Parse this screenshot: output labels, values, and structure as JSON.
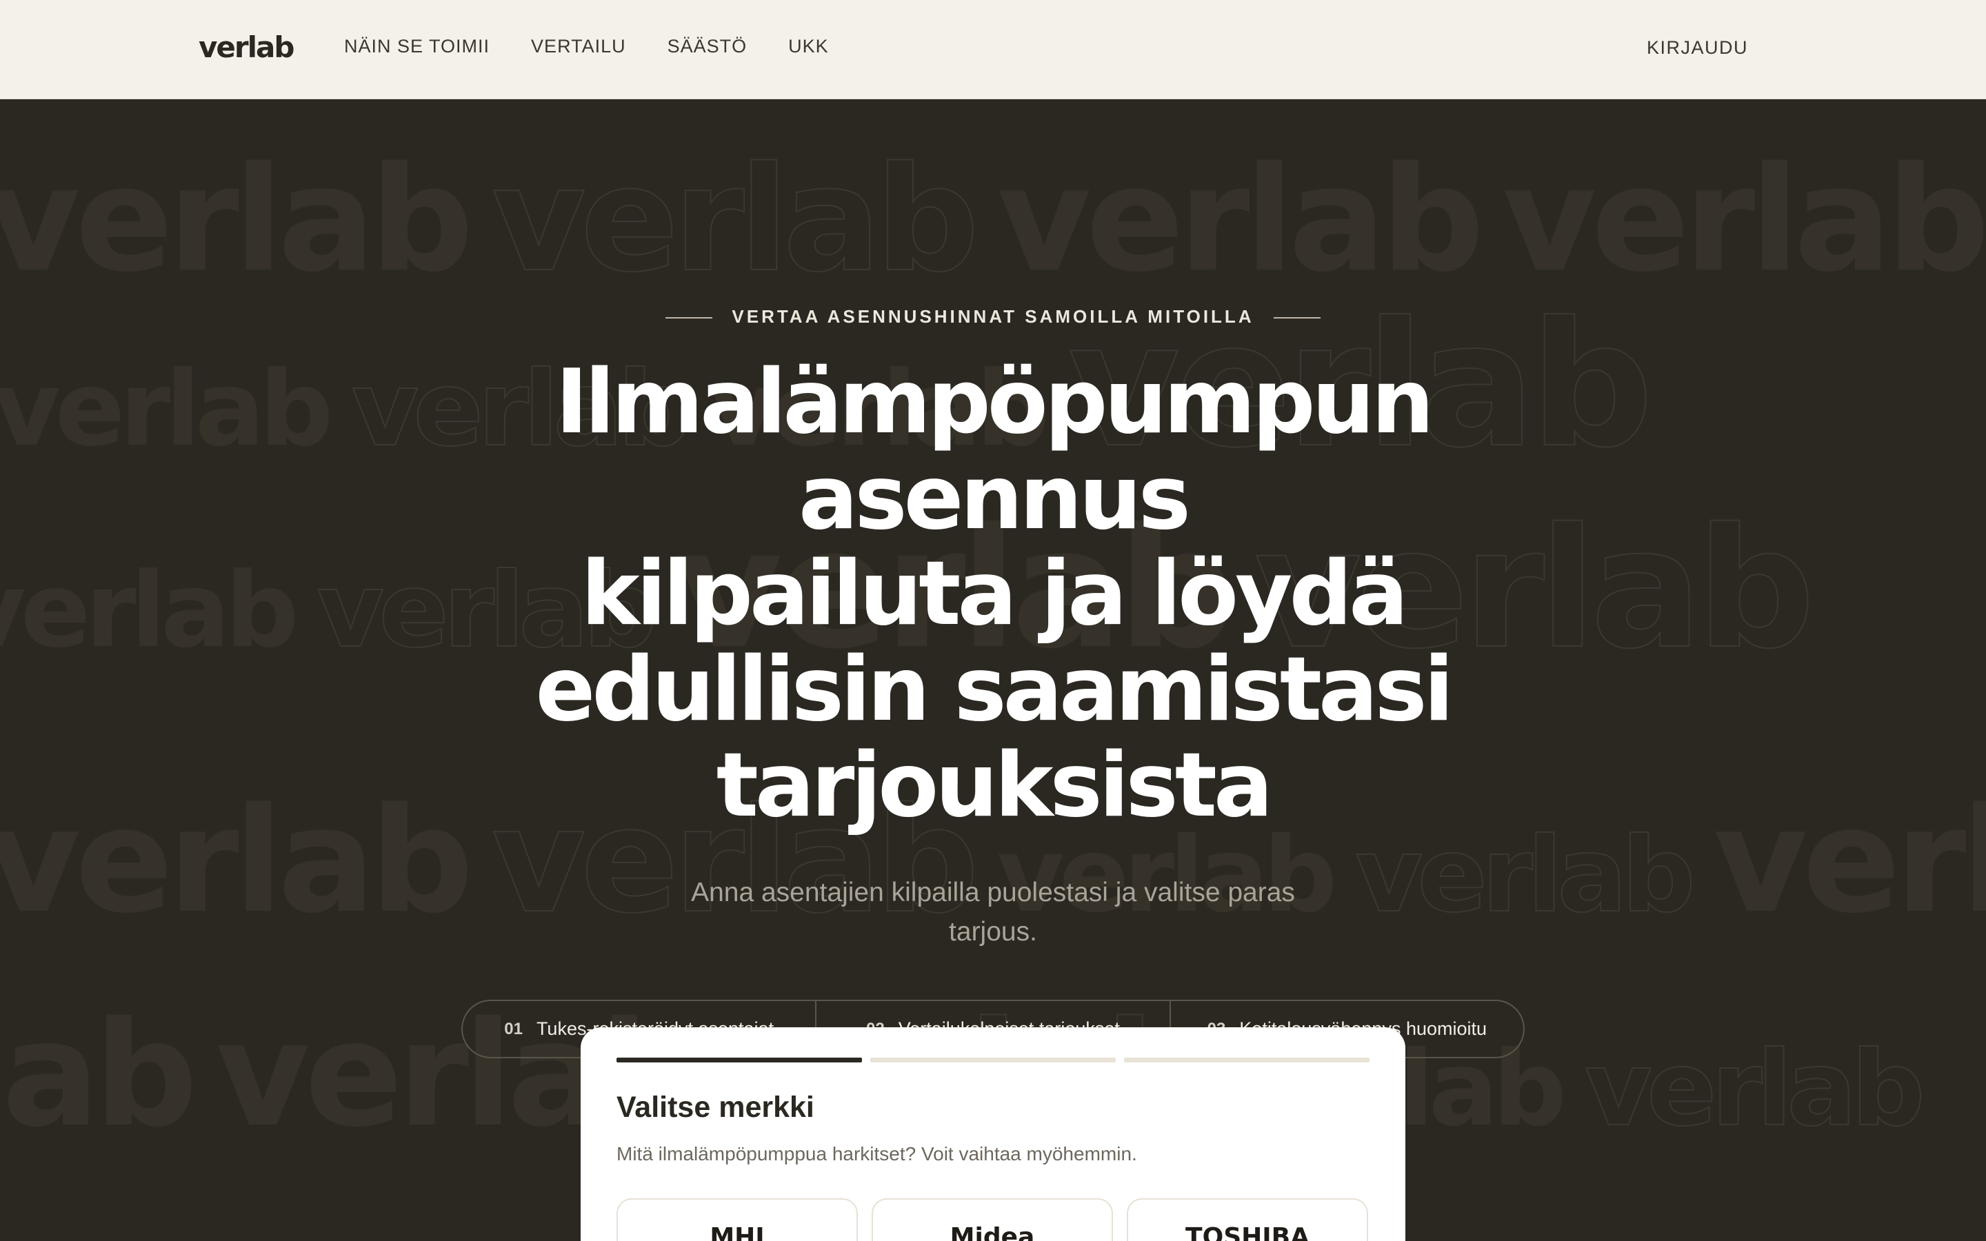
{
  "header": {
    "logo": "verlab",
    "nav": [
      "NÄIN SE TOIMII",
      "VERTAILU",
      "SÄÄSTÖ",
      "UKK"
    ],
    "login": "KIRJAUDU"
  },
  "hero": {
    "eyebrow": "VERTAA ASENNUSHINNAT SAMOILLA MITOILLA",
    "headline_lines": [
      "Ilmalämpöpumpun",
      "asennus",
      "kilpailuta ja löydä",
      "edullisin saamistasi",
      "tarjouksista"
    ],
    "subtitle": "Anna asentajien kilpailla puolestasi ja valitse paras tarjous.",
    "watermark": "verlab",
    "features": [
      {
        "num": "01",
        "label": "Tukes-rekisteröidyt asentajat"
      },
      {
        "num": "02",
        "label": "Vertailukelpoiset tarjoukset"
      },
      {
        "num": "03",
        "label": "Kotitalousvähennys huomioitu"
      }
    ]
  },
  "wizard": {
    "steps_total": 3,
    "current_step": 1,
    "title": "Valitse merkki",
    "subtitle": "Mitä ilmalämpöpumppua harkitset? Voit vaihtaa myöhemmin.",
    "brands": [
      "MHI",
      "Midea",
      "TOSHIBA"
    ]
  },
  "colors": {
    "header_bg": "#f4f0ea",
    "hero_bg": "#2b2822",
    "text_dark": "#2b2822",
    "text_light": "#ffffff"
  }
}
